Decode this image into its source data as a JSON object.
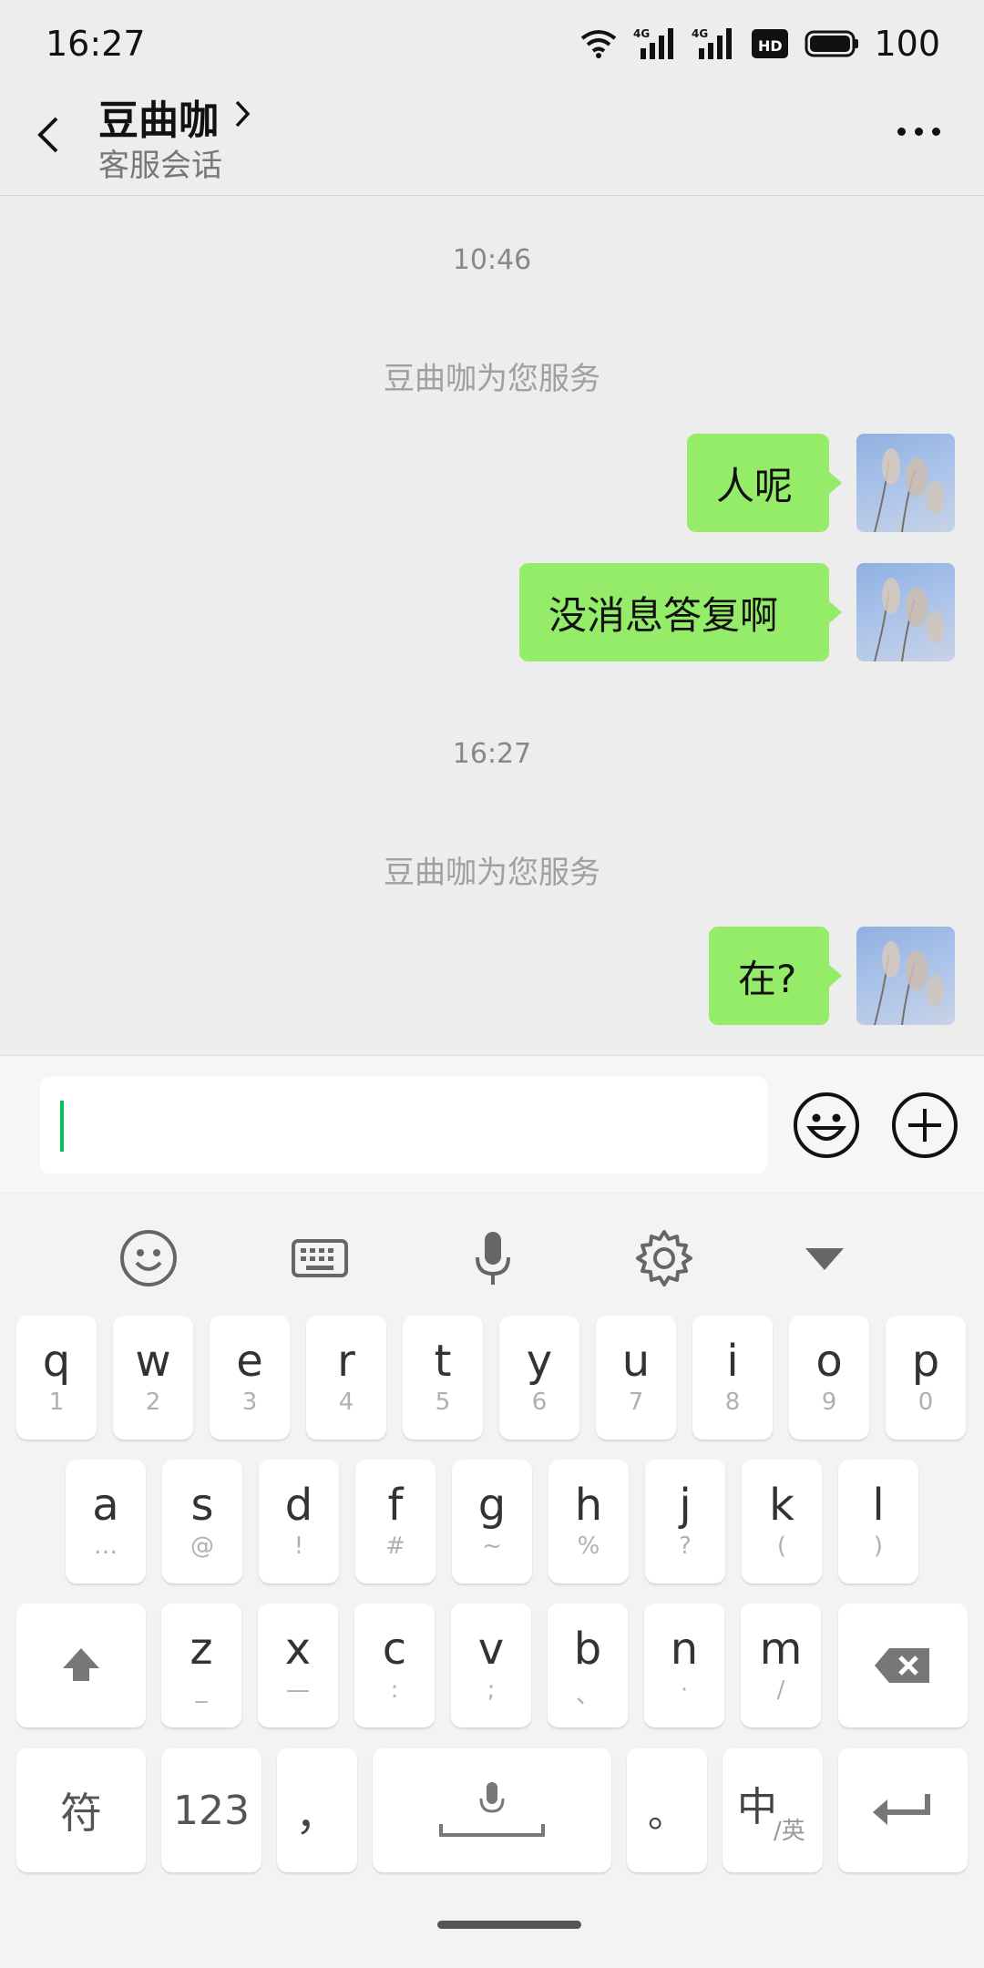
{
  "status": {
    "time": "16:27",
    "battery": "100",
    "net1": "4G",
    "net2": "4G",
    "hd": "HD"
  },
  "header": {
    "title": "豆曲咖",
    "subtitle": "客服会话"
  },
  "chat": {
    "ts1": "10:46",
    "sys1": "豆曲咖为您服务",
    "msg1": "人呢",
    "msg2": "没消息答复啊",
    "ts2": "16:27",
    "sys2": "豆曲咖为您服务",
    "msg3": "在?"
  },
  "input": {
    "value": ""
  },
  "keyboard": {
    "row1": [
      {
        "k": "q",
        "s": "1"
      },
      {
        "k": "w",
        "s": "2"
      },
      {
        "k": "e",
        "s": "3"
      },
      {
        "k": "r",
        "s": "4"
      },
      {
        "k": "t",
        "s": "5"
      },
      {
        "k": "y",
        "s": "6"
      },
      {
        "k": "u",
        "s": "7"
      },
      {
        "k": "i",
        "s": "8"
      },
      {
        "k": "o",
        "s": "9"
      },
      {
        "k": "p",
        "s": "0"
      }
    ],
    "row2": [
      {
        "k": "a",
        "s": "…"
      },
      {
        "k": "s",
        "s": "@"
      },
      {
        "k": "d",
        "s": "!"
      },
      {
        "k": "f",
        "s": "#"
      },
      {
        "k": "g",
        "s": "~"
      },
      {
        "k": "h",
        "s": "%"
      },
      {
        "k": "j",
        "s": "?"
      },
      {
        "k": "k",
        "s": "("
      },
      {
        "k": "l",
        "s": ")"
      }
    ],
    "row3": [
      {
        "k": "z",
        "s": "_"
      },
      {
        "k": "x",
        "s": "—"
      },
      {
        "k": "c",
        "s": ":"
      },
      {
        "k": "v",
        "s": ";"
      },
      {
        "k": "b",
        "s": "、"
      },
      {
        "k": "n",
        "s": "·"
      },
      {
        "k": "m",
        "s": "/"
      }
    ],
    "symbol": "符",
    "num": "123",
    "comma": "，",
    "period": "。",
    "lang_main": "中",
    "lang_sub": "/英"
  }
}
